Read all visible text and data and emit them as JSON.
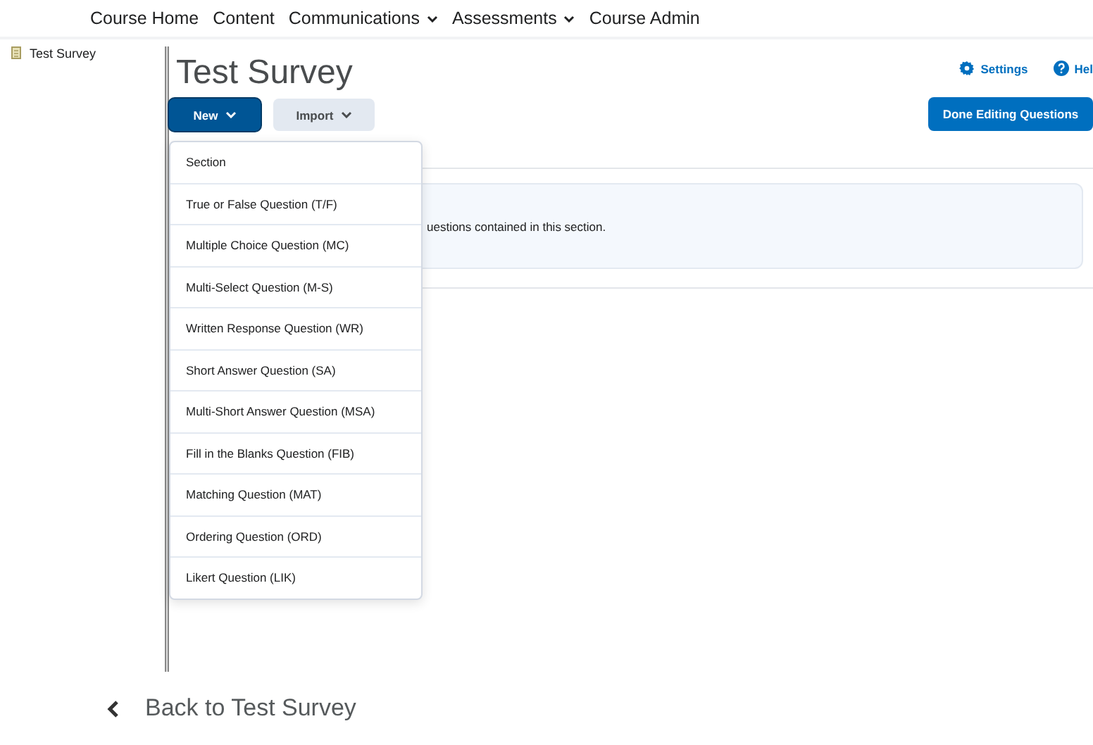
{
  "top_nav": [
    {
      "label": "Course Home",
      "dropdown": false
    },
    {
      "label": "Content",
      "dropdown": false
    },
    {
      "label": "Communications",
      "dropdown": true
    },
    {
      "label": "Assessments",
      "dropdown": true
    },
    {
      "label": "Course Admin",
      "dropdown": false
    }
  ],
  "sidebar": {
    "items": [
      {
        "label": "Test Survey"
      }
    ]
  },
  "page": {
    "title": "Test Survey",
    "toolbar": [
      {
        "label": "New",
        "kind": "primary",
        "expanded": true
      },
      {
        "label": "Import",
        "kind": "secondary",
        "expanded": false
      }
    ],
    "links": [
      {
        "label": "Settings",
        "kind": "settings"
      },
      {
        "label": "Hel",
        "kind": "help"
      }
    ],
    "done_button": "Done Editing Questions",
    "info_text": "uestions contained in this section."
  },
  "new_menu": {
    "items": [
      {
        "label": "Section"
      },
      {
        "label": "True or False Question (T/F)"
      },
      {
        "label": "Multiple Choice Question (MC)"
      },
      {
        "label": "Multi-Select Question (M-S)"
      },
      {
        "label": "Written Response Question (WR)"
      },
      {
        "label": "Short Answer Question (SA)"
      },
      {
        "label": "Multi-Short Answer Question (MSA)"
      },
      {
        "label": "Fill in the Blanks Question (FIB)"
      },
      {
        "label": "Matching Question (MAT)"
      },
      {
        "label": "Ordering Question (ORD)"
      },
      {
        "label": "Likert Question (LIK)"
      }
    ]
  },
  "back_link": "Back to Test Survey"
}
